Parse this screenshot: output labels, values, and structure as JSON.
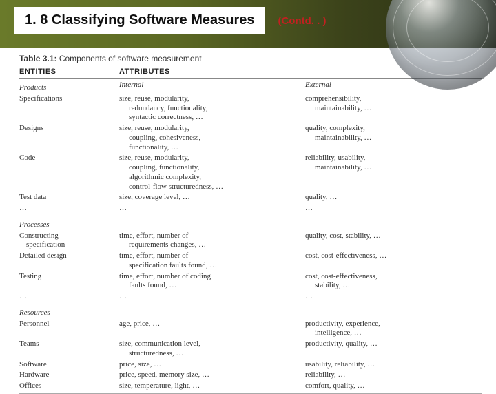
{
  "header": {
    "title": "1. 8 Classifying Software Measures",
    "contd": "(Contd. . )"
  },
  "table": {
    "caption_label": "Table 3.1:",
    "caption_text": "Components of software measurement",
    "header": {
      "entities": "ENTITIES",
      "attributes": "ATTRIBUTES"
    },
    "col_labels": {
      "internal": "Internal",
      "external": "External"
    }
  },
  "chart_data": {
    "type": "table",
    "title": "Components of software measurement",
    "columns": [
      "ENTITIES",
      "Internal",
      "External"
    ],
    "sections": [
      {
        "name": "Products",
        "rows": [
          {
            "entity": "Specifications",
            "internal": "size, reuse, modularity, redundancy, functionality, syntactic correctness, …",
            "external": "comprehensibility, maintainability, …"
          },
          {
            "entity": "Designs",
            "internal": "size, reuse, modularity, coupling, cohesiveness, functionality, …",
            "external": "quality, complexity, maintainability, …"
          },
          {
            "entity": "Code",
            "internal": "size, reuse, modularity, coupling, functionality, algorithmic complexity, control-flow structuredness, …",
            "external": "reliability, usability, maintainability, …"
          },
          {
            "entity": "Test data",
            "internal": "size, coverage level, …",
            "external": "quality, …"
          },
          {
            "entity": "…",
            "internal": "…",
            "external": "…"
          }
        ]
      },
      {
        "name": "Processes",
        "rows": [
          {
            "entity": "Constructing specification",
            "internal": "time, effort, number of requirements changes, …",
            "external": "quality, cost, stability, …"
          },
          {
            "entity": "Detailed design",
            "internal": "time, effort, number of specification faults found, …",
            "external": "cost, cost-effectiveness, …"
          },
          {
            "entity": "Testing",
            "internal": "time, effort, number of coding faults found, …",
            "external": "cost, cost-effectiveness, stability, …"
          },
          {
            "entity": "…",
            "internal": "…",
            "external": "…"
          }
        ]
      },
      {
        "name": "Resources",
        "rows": [
          {
            "entity": "Personnel",
            "internal": "age, price, …",
            "external": "productivity, experience, intelligence, …"
          },
          {
            "entity": "Teams",
            "internal": "size, communication level, structuredness, …",
            "external": "productivity, quality, …"
          },
          {
            "entity": "Software",
            "internal": "price, size, …",
            "external": "usability, reliability, …"
          },
          {
            "entity": "Hardware",
            "internal": "price, speed, memory size, …",
            "external": "reliability, …"
          },
          {
            "entity": "Offices",
            "internal": "size, temperature, light, …",
            "external": "comfort, quality, …"
          }
        ]
      }
    ]
  }
}
